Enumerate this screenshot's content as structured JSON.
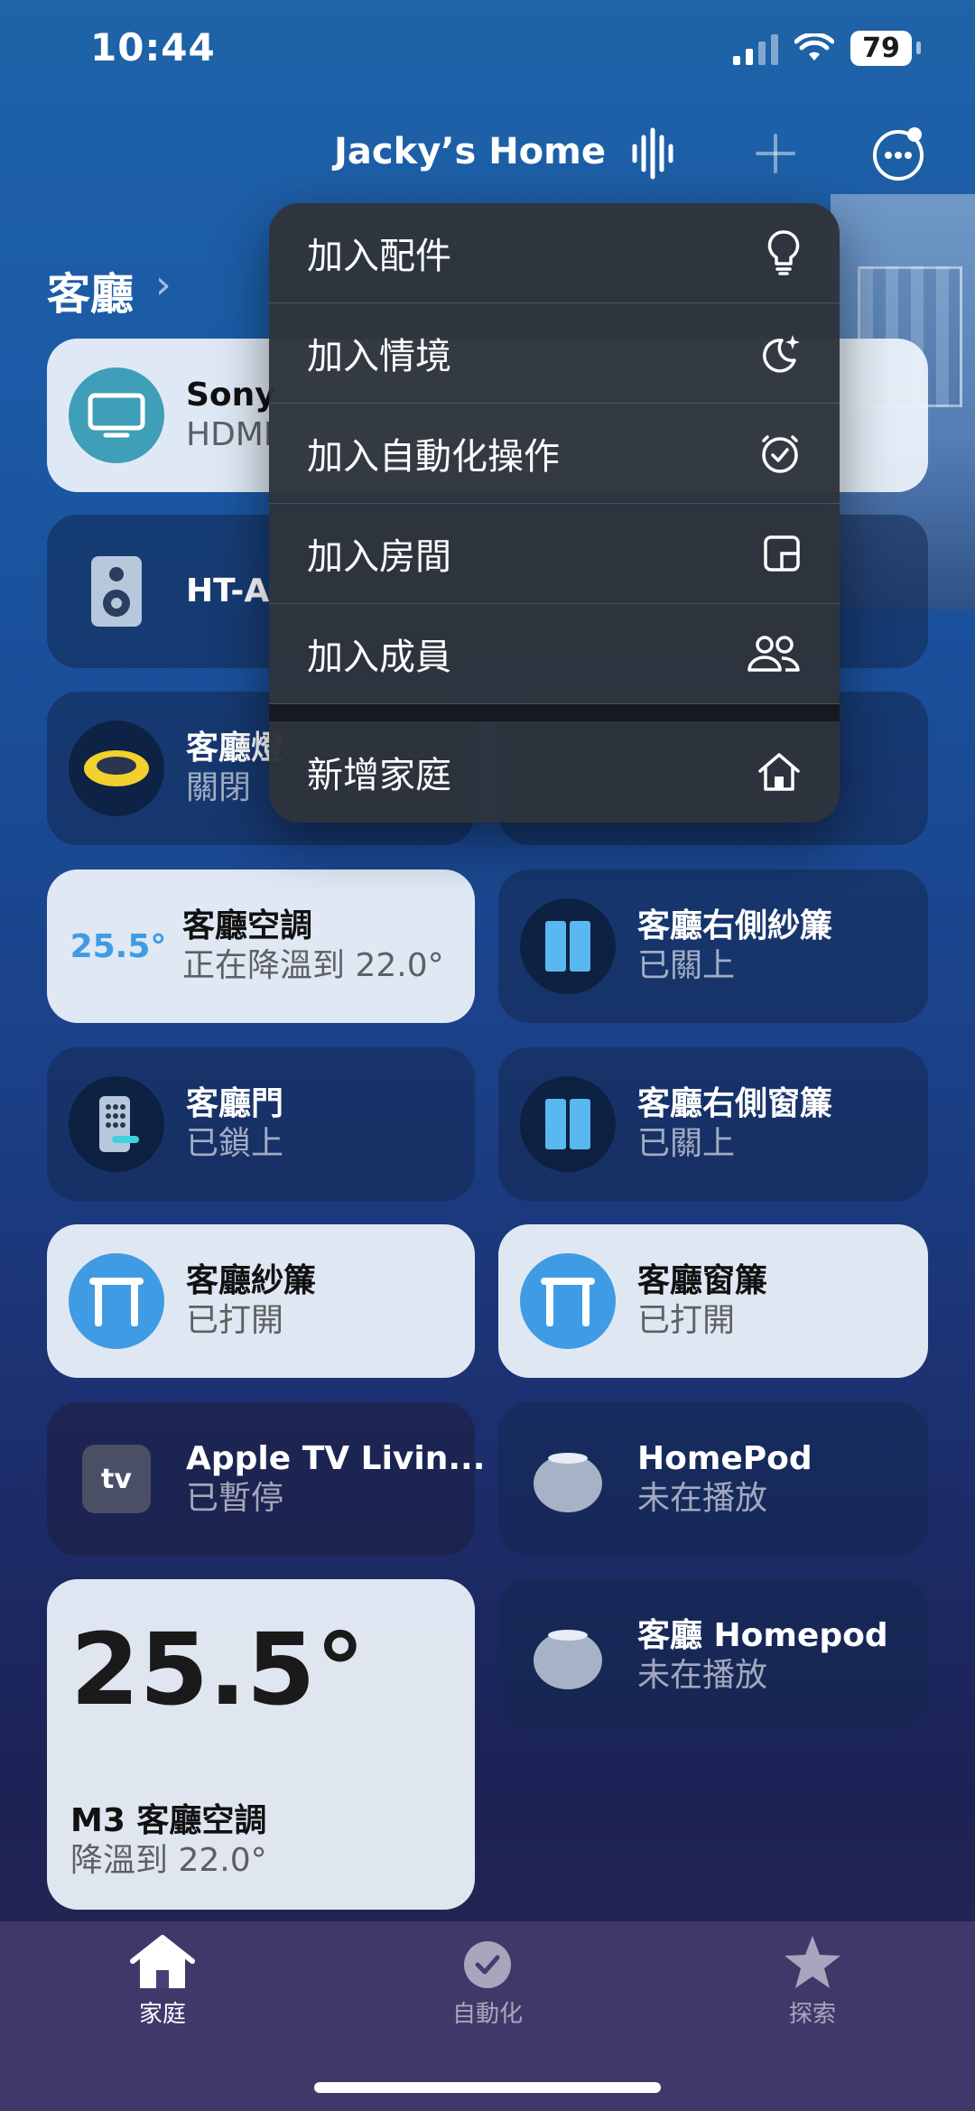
{
  "status_bar": {
    "time": "10:44",
    "battery": "79"
  },
  "header": {
    "home_name": "Jacky’s Home"
  },
  "room": {
    "title": "客廳"
  },
  "menu": {
    "items": [
      {
        "label": "加入配件",
        "icon": "lightbulb-icon"
      },
      {
        "label": "加入情境",
        "icon": "moon-sparkle-icon"
      },
      {
        "label": "加入自動化操作",
        "icon": "clock-check-icon"
      },
      {
        "label": "加入房間",
        "icon": "room-icon"
      },
      {
        "label": "加入成員",
        "icon": "people-icon"
      }
    ],
    "extra": {
      "label": "新增家庭",
      "icon": "house-icon"
    }
  },
  "tiles": {
    "sony": {
      "name": "Sony",
      "status": "HDMI"
    },
    "ht": {
      "name": "HT-A"
    },
    "light": {
      "name": "客廳燈",
      "status": "關閉"
    },
    "aircon": {
      "temp": "25.5°",
      "name": "客廳空調",
      "status": "正在降溫到 22.0°"
    },
    "right_sheer": {
      "name": "客廳右側紗簾",
      "status": "已關上"
    },
    "door": {
      "name": "客廳門",
      "status": "已鎖上"
    },
    "right_curtain": {
      "name": "客廳右側窗簾",
      "status": "已關上"
    },
    "sheer": {
      "name": "客廳紗簾",
      "status": "已打開"
    },
    "curtain": {
      "name": "客廳窗簾",
      "status": "已打開"
    },
    "appletv": {
      "name": "Apple TV Livin...",
      "status": "已暫停",
      "badge": "tv"
    },
    "homepod": {
      "name": "HomePod",
      "status": "未在播放"
    },
    "homepod2": {
      "name": "客廳 Homepod",
      "status": "未在播放"
    },
    "thermo_big": {
      "temp": "25.5°",
      "name": "M3 客廳空調",
      "status": "降溫到 22.0°"
    }
  },
  "tabbar": {
    "home": "家庭",
    "automation": "自動化",
    "discover": "探索"
  },
  "colors": {
    "accent_blue": "#3f9be3",
    "tile_light": "#ecf2fa",
    "menu_bg": "#2e343c"
  }
}
